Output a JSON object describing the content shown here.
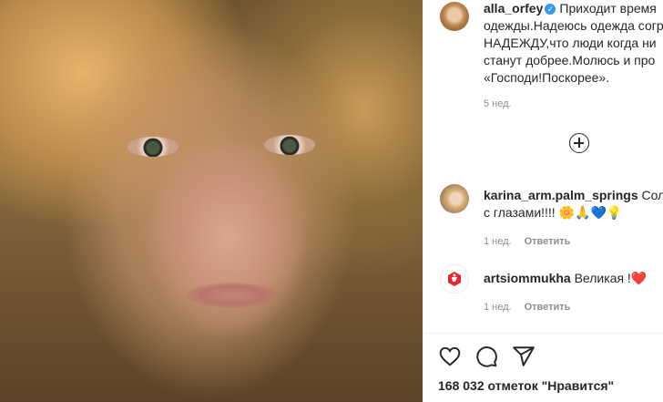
{
  "post": {
    "author": "alla_orfey",
    "caption_lines": [
      "Приходит время",
      "одежды.Надеюсь одежда согр",
      "НАДЕЖДУ,что люди когда ни",
      "станут добрее.Молюсь и про",
      "«Господи!Поскорее»."
    ],
    "time": "5 нед."
  },
  "comments": [
    {
      "username": "karina_arm.palm_springs",
      "text_line1": "Солн",
      "text_line2": "с глазами!!!! 🌼🙏💙💡",
      "time": "1 нед.",
      "reply_label": "Ответить"
    },
    {
      "username": "artsiommukha",
      "text": "Великая !❤️",
      "time": "1 нед.",
      "reply_label": "Ответить"
    }
  ],
  "likes_label": "168 032 отметок \"Нравится\"",
  "icons": [
    "heart-icon",
    "comment-icon",
    "share-icon",
    "add-comment-icon",
    "verified-badge-icon"
  ],
  "colors": {
    "verified": "#3897f0",
    "heart": "#ed4956",
    "text": "#262626",
    "muted": "#8e8e8e"
  }
}
